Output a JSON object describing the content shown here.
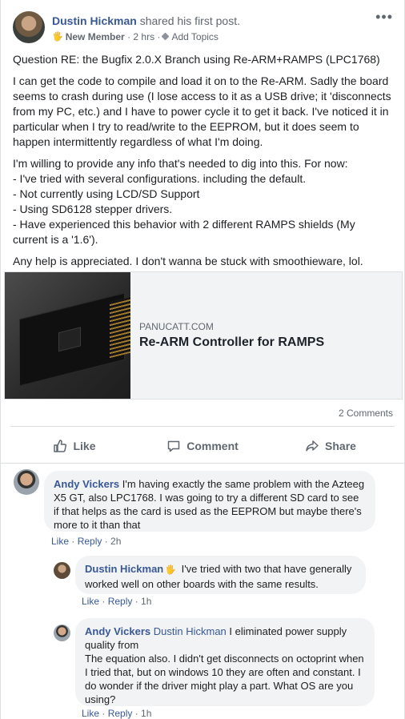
{
  "post": {
    "author": "Dustin Hickman",
    "action": "shared his first post.",
    "badge": "New Member",
    "time": "2 hrs",
    "add_topics": "Add Topics",
    "more": "•••",
    "paragraphs": [
      "Question RE: the Bugfix 2.0.X Branch using Re-ARM+RAMPS (LPC1768)",
      "I can get the code to compile and load it on to the Re-ARM. Sadly the board seems to crash during use (I lose access to it as a USB drive; it 'disconnects from my PC, etc.) and I have to power cycle it to get it back. I've noticed it in particular when I try to read/write to the EEPROM, but it does seem to happen intermittently regardless of what I'm doing.",
      "I'm willing to provide any info that's needed to dig into this. For now:",
      "- I've tried with several configurations. including the default.",
      "- Not currently using LCD/SD Support",
      "- Using SD6128 stepper drivers.",
      "- Have experienced this behavior with 2 different RAMPS shields (My current is a '1.6').",
      "Any help is appreciated. I don't wanna be stuck with smoothieware, lol."
    ]
  },
  "link_preview": {
    "domain": "PANUCATT.COM",
    "title": "Re-ARM Controller for RAMPS"
  },
  "stats": {
    "comments": "2 Comments"
  },
  "actions": {
    "like": "Like",
    "comment": "Comment",
    "share": "Share"
  },
  "comments": [
    {
      "author": "Andy Vickers",
      "text": "I'm having exactly the same problem with the Azteeg X5 GT, also LPC1768. I was going to try a different SD card to see if that helps as the card is used as the EEPROM but maybe there's more to it than that",
      "like": "Like",
      "reply": "Reply",
      "time": "2h"
    },
    {
      "author": "Dustin Hickman",
      "text": "I've tried with two that have generally worked well on other boards with the same results.",
      "like": "Like",
      "reply": "Reply",
      "time": "1h"
    },
    {
      "author": "Andy Vickers",
      "mention": "Dustin Hickman",
      "text": "I eliminated power supply quality from",
      "text2": "The equation also. I didn't get disconnects on octoprint when I tried that, but on windows 10 they are often and constant. I do wonder if the driver might play a part. What OS are you using?",
      "like": "Like",
      "reply": "Reply",
      "time": "1h"
    }
  ],
  "colors": {
    "link": "#385898",
    "bubble": "#f2f3f5",
    "meta": "#606770"
  }
}
